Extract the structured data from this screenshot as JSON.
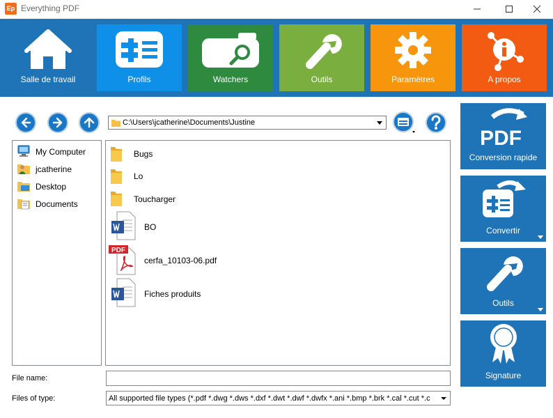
{
  "window": {
    "title": "Everything PDF",
    "icon_glyph": "Ep"
  },
  "ribbon": {
    "tiles": [
      {
        "label": "Salle de travail",
        "icon": "house-icon",
        "color": "#1f74b8"
      },
      {
        "label": "Profils",
        "icon": "profiles-icon",
        "color": "#0e90e8"
      },
      {
        "label": "Watchers",
        "icon": "watchers-icon",
        "color": "#2e8a3e"
      },
      {
        "label": "Outils",
        "icon": "wrench-icon",
        "color": "#7aae3f"
      },
      {
        "label": "Paramètres",
        "icon": "gear-icon",
        "color": "#f7960d"
      },
      {
        "label": "A propos",
        "icon": "info-icon",
        "color": "#f35b12"
      }
    ]
  },
  "nav": {
    "path": "C:\\Users\\jcatherine\\Documents\\Justine"
  },
  "tree": {
    "items": [
      {
        "label": "My Computer",
        "icon": "computer-icon"
      },
      {
        "label": "jcatherine",
        "icon": "user-folder-icon"
      },
      {
        "label": "Desktop",
        "icon": "desktop-folder-icon"
      },
      {
        "label": "Documents",
        "icon": "documents-folder-icon"
      }
    ]
  },
  "files": {
    "items": [
      {
        "label": "Bugs",
        "icon": "folder-icon"
      },
      {
        "label": "Lo",
        "icon": "folder-icon"
      },
      {
        "label": "Toucharger",
        "icon": "folder-icon"
      },
      {
        "label": "BO",
        "icon": "word-document-icon"
      },
      {
        "label": "cerfa_10103-06.pdf",
        "icon": "pdf-file-icon",
        "badge": "PDF"
      },
      {
        "label": "Fiches produits",
        "icon": "word-document-icon"
      }
    ]
  },
  "form": {
    "filename_label": "File name:",
    "filename_value": "",
    "filetype_label": "Files of type:",
    "filetype_value": "All supported file types (*.pdf *.dwg *.dws *.dxf *.dwt *.dwf *.dwfx *.ani *.bmp *.brk *.cal *.cut *.c"
  },
  "side_panel": {
    "tiles": [
      {
        "label": "Conversion rapide",
        "icon": "pdf-quick-convert-icon",
        "icon_text": "PDF"
      },
      {
        "label": "Convertir",
        "icon": "convert-icon"
      },
      {
        "label": "Outils",
        "icon": "wrench-icon"
      },
      {
        "label": "Signature",
        "icon": "signature-seal-icon"
      }
    ]
  },
  "colors": {
    "ribbon_bg": "#1f74b8",
    "accent": "#1877c6",
    "folder": "#f5c04a"
  }
}
